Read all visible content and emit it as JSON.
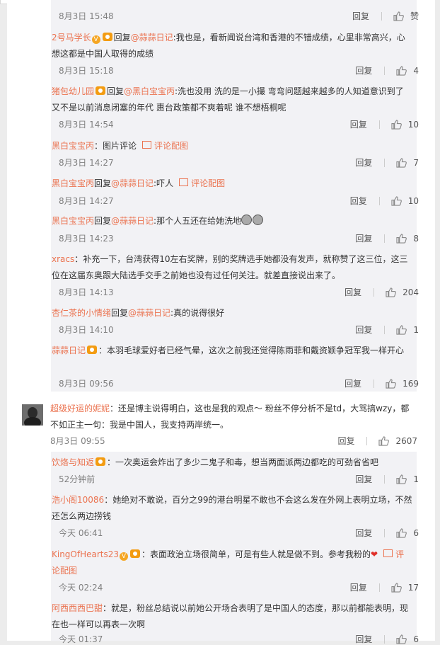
{
  "labels": {
    "reply": "回复",
    "reply_prefix": "回复",
    "pic_comment": "评论配图"
  },
  "comments": [
    {
      "time": "8月3日 15:48",
      "likes": "赞"
    },
    {
      "name": "2号马学长",
      "target": "@蒜蒜日记",
      "text": ":我也是，看新闻说台湾和香港的不错成绩，心里非常高兴，心想这都是中国人取得的成绩",
      "time": "8月3日 15:18",
      "likes": "4"
    },
    {
      "name": "猪包幼儿园",
      "target": "@黑白宝宝丙",
      "text": ":洗也没用 洗的是一小撮 弯弯问题越来越多的人知道意识到了 又不是以前消息闭塞的年代 惠台政策都不爽着呢 谁不想梧桐呢",
      "time": "8月3日 14:54",
      "likes": "10"
    },
    {
      "name": "黑白宝宝丙",
      "text": "：图片评论",
      "time": "8月3日 14:27",
      "likes": "7"
    },
    {
      "name": "黑白宝宝丙",
      "target": "@蒜蒜日记",
      "text": ":吓人",
      "time": "8月3日 14:27",
      "likes": "10"
    },
    {
      "name": "黑白宝宝丙",
      "target": "@蒜蒜日记",
      "text": ":那个人五还在给她洗地",
      "time": "8月3日 14:23",
      "likes": "8"
    },
    {
      "name": "xracs",
      "text": "：补充一下，台湾获得10左右奖牌，别的奖牌选手她都没有发声，就称赞了这三位，这三位在这届东奥跟大陆选手交手之前她也没有过任何关注。就差直接说出来了。",
      "time": "8月3日 14:13",
      "likes": "204"
    },
    {
      "name": "杏仁茶的小情绪",
      "target": "@蒜蒜日记",
      "text": ":真的说得很好",
      "time": "8月3日 14:10",
      "likes": "1"
    },
    {
      "name": "蒜蒜日记",
      "text": "：本羽毛球爱好者已经气晕，这次之前我还觉得陈雨菲和戴资颖争冠军我一样开心",
      "time": "8月3日 09:56",
      "likes": "169"
    }
  ],
  "main_comment": {
    "name": "超级好运的妮妮",
    "text": "：还是博主说得明白，这也是我的观点～ 粉丝不停分析不是td，大骂搞wzy，都不如正主一句：我是中国人，我支持两岸统一。",
    "time": "8月3日 09:55",
    "likes": "2607"
  },
  "replies": [
    {
      "name": "饮烙与知返",
      "text": "：一次奥运会炸出了多少二鬼子和毒，想当两面派两边都吃的可劲省省吧",
      "time": "52分钟前",
      "likes": "1"
    },
    {
      "name": "浩小阁10086",
      "text": "：她绝对不敢说，百分之99的港台明星不敢也不会这么发在外网上表明立场，不然还怎么两边捞钱",
      "time": "今天 06:41",
      "likes": "6"
    },
    {
      "name": "KingOfHearts23",
      "text": "：表面政治立场很简单，可是有些人就是做不到。参考我粉的",
      "time": "今天 02:24",
      "likes": "17"
    },
    {
      "name": "阿西西西巴甜",
      "text": "：就是，粉丝总结说以前她公开场合表明了是中国人的态度，那以前都能表明，现在也一样可以再表一次啊",
      "time": "今天 01:37",
      "likes": "6"
    }
  ]
}
